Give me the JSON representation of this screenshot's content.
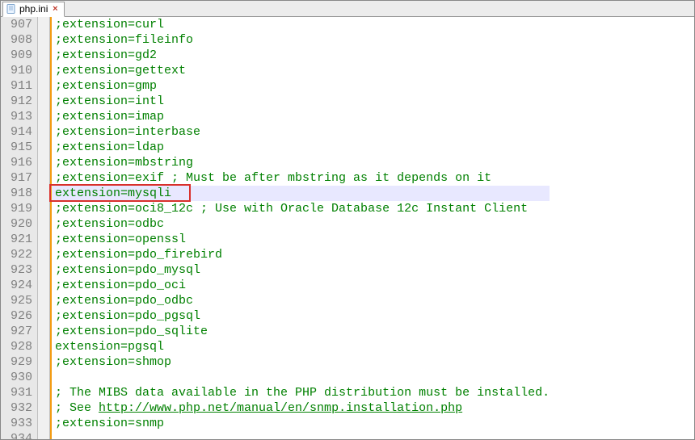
{
  "tab": {
    "filename": "php.ini",
    "close_glyph": "×"
  },
  "editor": {
    "lines": [
      {
        "num": 907,
        "type": "comment",
        "text": ";extension=curl"
      },
      {
        "num": 908,
        "type": "comment",
        "text": ";extension=fileinfo"
      },
      {
        "num": 909,
        "type": "comment",
        "text": ";extension=gd2"
      },
      {
        "num": 910,
        "type": "comment",
        "text": ";extension=gettext"
      },
      {
        "num": 911,
        "type": "comment",
        "text": ";extension=gmp"
      },
      {
        "num": 912,
        "type": "comment",
        "text": ";extension=intl"
      },
      {
        "num": 913,
        "type": "comment",
        "text": ";extension=imap"
      },
      {
        "num": 914,
        "type": "comment",
        "text": ";extension=interbase"
      },
      {
        "num": 915,
        "type": "comment",
        "text": ";extension=ldap"
      },
      {
        "num": 916,
        "type": "comment",
        "text": ";extension=mbstring"
      },
      {
        "num": 917,
        "type": "comment",
        "text": ";extension=exif      ; Must be after mbstring as it depends on it"
      },
      {
        "num": 918,
        "type": "active",
        "text": "extension=mysqli",
        "current": true,
        "highlighted": true
      },
      {
        "num": 919,
        "type": "comment",
        "text": ";extension=oci8_12c  ; Use with Oracle Database 12c Instant Client"
      },
      {
        "num": 920,
        "type": "comment",
        "text": ";extension=odbc"
      },
      {
        "num": 921,
        "type": "comment",
        "text": ";extension=openssl"
      },
      {
        "num": 922,
        "type": "comment",
        "text": ";extension=pdo_firebird"
      },
      {
        "num": 923,
        "type": "comment",
        "text": ";extension=pdo_mysql"
      },
      {
        "num": 924,
        "type": "comment",
        "text": ";extension=pdo_oci"
      },
      {
        "num": 925,
        "type": "comment",
        "text": ";extension=pdo_odbc"
      },
      {
        "num": 926,
        "type": "comment",
        "text": ";extension=pdo_pgsql"
      },
      {
        "num": 927,
        "type": "comment",
        "text": ";extension=pdo_sqlite"
      },
      {
        "num": 928,
        "type": "active",
        "text": "extension=pgsql"
      },
      {
        "num": 929,
        "type": "comment",
        "text": ";extension=shmop"
      },
      {
        "num": 930,
        "type": "blank",
        "text": ""
      },
      {
        "num": 931,
        "type": "comment",
        "text": "; The MIBS data available in the PHP distribution must be installed."
      },
      {
        "num": 932,
        "type": "comment-link",
        "prefix": "; See ",
        "link": "http://www.php.net/manual/en/snmp.installation.php"
      },
      {
        "num": 933,
        "type": "comment",
        "text": ";extension=snmp"
      },
      {
        "num": 934,
        "type": "blank",
        "text": ""
      }
    ]
  },
  "colors": {
    "comment": "#008000",
    "gutter_bg": "#e8e8e8",
    "gutter_fg": "#808080",
    "margin": "#f39c12",
    "current_line": "#e8e8ff",
    "highlight_border": "#d9302c"
  }
}
